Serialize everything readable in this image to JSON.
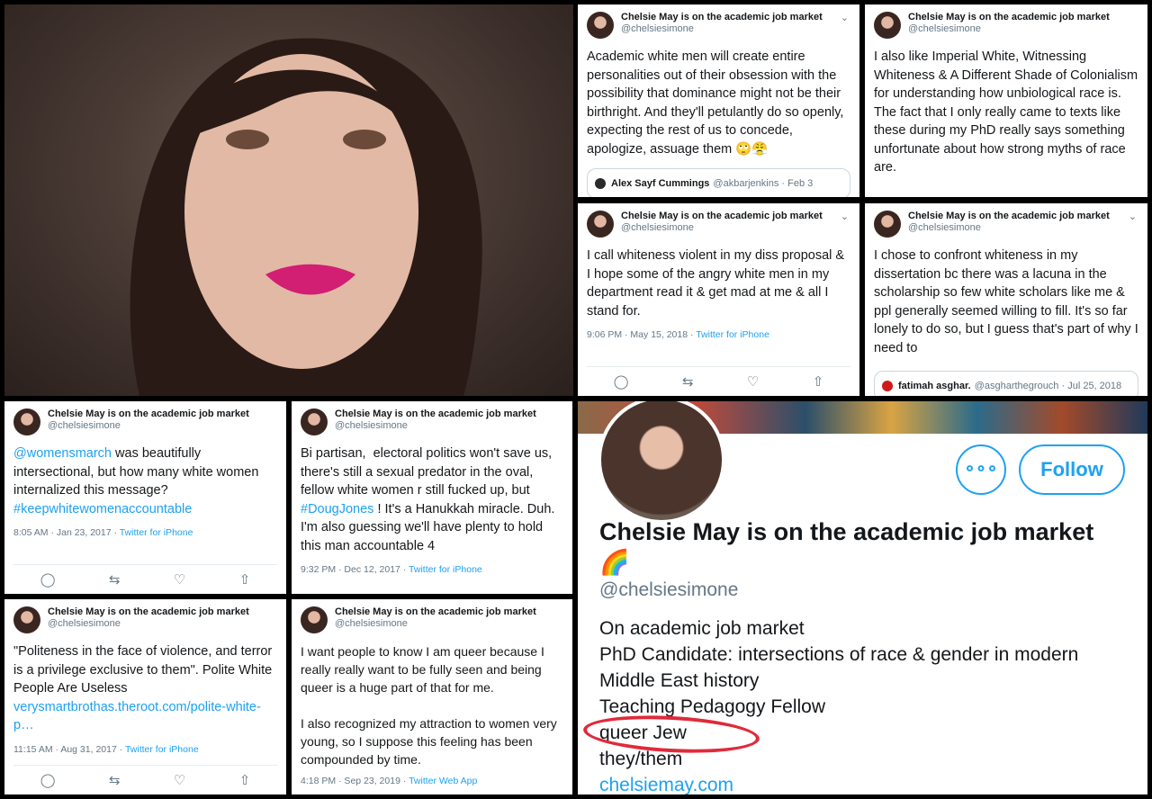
{
  "account": {
    "name": "Chelsie May is on the academic job market",
    "handle": "@chelsiesimone",
    "rainbow_emoji": "🌈"
  },
  "tweets": {
    "t1": {
      "body": "Academic white men will create entire personalities out of their obsession with the possibility that dominance might not be their birthright. And they'll petulantly do so openly, expecting the rest of us to concede, apologize, assuage them 🙄😤",
      "quote_name": "Alex Sayf Cummings",
      "quote_handle": "@akbarjenkins · Feb 3"
    },
    "t2": {
      "body": "I also like Imperial White, Witnessing Whiteness & A Different Shade of Colonialism for understanding how unbiological race is. The fact that I only really came to texts like these during my PhD really says something unfortunate about how strong myths of race are."
    },
    "t3": {
      "body": "I call whiteness violent in my diss proposal & I hope some of the angry white men in my department read it & get mad at me & all I stand for.",
      "time": "9:06 PM · May 15, 2018 · ",
      "source": "Twitter for iPhone"
    },
    "t4": {
      "body": "I chose to confront whiteness in my dissertation bc there was a lacuna in the scholarship so few white scholars like me & ppl generally seemed willing to fill. It's so far lonely to do so, but I guess that's part of why I need to",
      "quote_name": "fatimah asghar.",
      "quote_handle": "@asgharthegrouch · Jul 25, 2018"
    },
    "t5": {
      "mention": "@womensmarch",
      "body": " was beautifully intersectional, but how many white women internalized this message? ",
      "hashtag": "#keepwhitewomenaccountable",
      "time": "8:05 AM · Jan 23, 2017 · ",
      "source": "Twitter for iPhone"
    },
    "t6": {
      "body_a": "Bi partisan,  electoral politics won't save us, there's still a sexual predator in the oval, fellow white women r still fucked up, but ",
      "hashtag": "#DougJones",
      "body_b": " ! It's a Hanukkah miracle. Duh. I'm also guessing we'll have plenty to hold this man accountable 4",
      "time": "9:32 PM · Dec 12, 2017 · ",
      "source": "Twitter for iPhone"
    },
    "t7": {
      "body": "\"Politeness in the face of violence, and terror is a privilege exclusive to them\". Polite White People Are Useless ",
      "link": "verysmartbrothas.theroot.com/polite-white-p…",
      "time": "11:15 AM · Aug 31, 2017 · ",
      "source": "Twitter for iPhone"
    },
    "t8": {
      "body": "I want people to know I am queer because I really really want to be fully seen and being queer is a huge part of that for me.\n\nI also recognized my attraction to women very young, so I suppose this feeling has been compounded by time.",
      "time": "4:18 PM · Sep 23, 2019 · ",
      "source": "Twitter Web App"
    }
  },
  "actions": {
    "reply": "◯",
    "retweet": "⇆",
    "like": "♡",
    "share": "⇧"
  },
  "profile": {
    "more_label": "∘∘∘",
    "follow_label": "Follow",
    "handle": "@chelsiesimone",
    "bio_lines": [
      "On academic job market",
      "PhD Candidate: intersections of race & gender in modern Middle East history",
      "Teaching Pedagogy Fellow",
      "queer Jew",
      "they/them"
    ],
    "website": "chelsiemay.com"
  },
  "colors": {
    "link": "#1da1f2",
    "muted": "#657786",
    "highlight_circle": "#e02a3a"
  }
}
